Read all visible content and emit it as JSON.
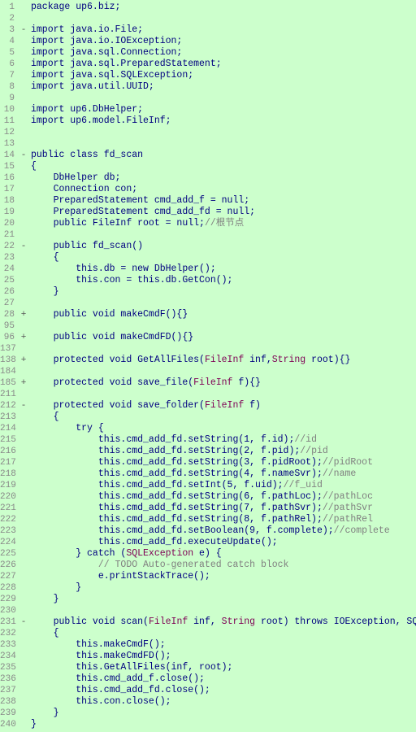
{
  "lines": [
    {
      "num": "1",
      "expand": "",
      "content": "package up6.biz;",
      "tokens": [
        {
          "t": "normal",
          "v": "package up6.biz;"
        }
      ]
    },
    {
      "num": "2",
      "expand": "",
      "content": "",
      "tokens": []
    },
    {
      "num": "3",
      "expand": "-",
      "content": "import java.io.File;",
      "tokens": [
        {
          "t": "normal",
          "v": "import java.io.File;"
        }
      ]
    },
    {
      "num": "4",
      "expand": "",
      "content": "import java.io.IOException;",
      "tokens": [
        {
          "t": "normal",
          "v": "import java.io.IOException;"
        }
      ]
    },
    {
      "num": "5",
      "expand": "",
      "content": "import java.sql.Connection;",
      "tokens": [
        {
          "t": "normal",
          "v": "import java.sql.Connection;"
        }
      ]
    },
    {
      "num": "6",
      "expand": "",
      "content": "import java.sql.PreparedStatement;",
      "tokens": [
        {
          "t": "normal",
          "v": "import java.sql.PreparedStatement;"
        }
      ]
    },
    {
      "num": "7",
      "expand": "",
      "content": "import java.sql.SQLException;",
      "tokens": [
        {
          "t": "normal",
          "v": "import java.sql.SQLException;"
        }
      ]
    },
    {
      "num": "8",
      "expand": "",
      "content": "import java.util.UUID;",
      "tokens": [
        {
          "t": "normal",
          "v": "import java.util.UUID;"
        }
      ]
    },
    {
      "num": "9",
      "expand": "",
      "content": "",
      "tokens": []
    },
    {
      "num": "10",
      "expand": "",
      "content": "import up6.DbHelper;",
      "tokens": [
        {
          "t": "normal",
          "v": "import up6.DbHelper;"
        }
      ]
    },
    {
      "num": "11",
      "expand": "",
      "content": "import up6.model.FileInf;",
      "tokens": [
        {
          "t": "normal",
          "v": "import up6.model.FileInf;"
        }
      ]
    },
    {
      "num": "12",
      "expand": "",
      "content": "",
      "tokens": []
    },
    {
      "num": "13",
      "expand": "",
      "content": "",
      "tokens": []
    },
    {
      "num": "14",
      "expand": "-",
      "content": "public class fd_scan",
      "tokens": [
        {
          "t": "kw",
          "v": "public class fd_scan"
        }
      ]
    },
    {
      "num": "15",
      "expand": "",
      "content": "{",
      "tokens": [
        {
          "t": "normal",
          "v": "{"
        }
      ]
    },
    {
      "num": "16",
      "expand": "",
      "content": "    DbHelper db;",
      "tokens": [
        {
          "t": "normal",
          "v": "    DbHelper db;"
        }
      ]
    },
    {
      "num": "17",
      "expand": "",
      "content": "    Connection con;",
      "tokens": [
        {
          "t": "normal",
          "v": "    Connection con;"
        }
      ]
    },
    {
      "num": "18",
      "expand": "",
      "content": "    PreparedStatement cmd_add_f = null;",
      "tokens": [
        {
          "t": "normal",
          "v": "    PreparedStatement cmd_add_f = null;"
        }
      ]
    },
    {
      "num": "19",
      "expand": "",
      "content": "    PreparedStatement cmd_add_fd = null;",
      "tokens": [
        {
          "t": "normal",
          "v": "    PreparedStatement cmd_add_fd = null;"
        }
      ]
    },
    {
      "num": "20",
      "expand": "",
      "content": "    public FileInf root = null;//根节点",
      "tokens": [
        {
          "t": "normal",
          "v": "    public FileInf root = null;"
        },
        {
          "t": "comment",
          "v": "//根节点"
        }
      ]
    },
    {
      "num": "21",
      "expand": "",
      "content": "",
      "tokens": []
    },
    {
      "num": "22",
      "expand": "-",
      "content": "    public fd_scan()",
      "tokens": [
        {
          "t": "normal",
          "v": "    public fd_scan()"
        }
      ]
    },
    {
      "num": "23",
      "expand": "",
      "content": "    {",
      "tokens": [
        {
          "t": "normal",
          "v": "    {"
        }
      ]
    },
    {
      "num": "24",
      "expand": "",
      "content": "        this.db = new DbHelper();",
      "tokens": [
        {
          "t": "normal",
          "v": "        this.db = new DbHelper();"
        }
      ]
    },
    {
      "num": "25",
      "expand": "",
      "content": "        this.con = this.db.GetCon();",
      "tokens": [
        {
          "t": "normal",
          "v": "        this.con = this.db.GetCon();"
        }
      ]
    },
    {
      "num": "26",
      "expand": "",
      "content": "    }",
      "tokens": [
        {
          "t": "normal",
          "v": "    }"
        }
      ]
    },
    {
      "num": "27",
      "expand": "",
      "content": "",
      "tokens": []
    },
    {
      "num": "28",
      "expand": "+",
      "content": "    public void makeCmdF(){}",
      "tokens": [
        {
          "t": "normal",
          "v": "    public void makeCmdF(){}"
        }
      ]
    },
    {
      "num": "95",
      "expand": "",
      "content": "",
      "tokens": []
    },
    {
      "num": "96",
      "expand": "+",
      "content": "    public void makeCmdFD(){}",
      "tokens": [
        {
          "t": "normal",
          "v": "    public void makeCmdFD(){}"
        }
      ]
    },
    {
      "num": "137",
      "expand": "",
      "content": "",
      "tokens": []
    },
    {
      "num": "138",
      "expand": "+",
      "content": "    protected void GetAllFiles(FileInf inf,String root){}",
      "tokens": [
        {
          "t": "normal",
          "v": "    protected void GetAllFiles("
        },
        {
          "t": "param",
          "v": "FileInf"
        },
        {
          "t": "normal",
          "v": " inf,"
        },
        {
          "t": "param",
          "v": "String"
        },
        {
          "t": "normal",
          "v": " root){}"
        }
      ]
    },
    {
      "num": "184",
      "expand": "",
      "content": "",
      "tokens": []
    },
    {
      "num": "185",
      "expand": "+",
      "content": "    protected void save_file(FileInf f){}",
      "tokens": [
        {
          "t": "normal",
          "v": "    protected void save_file("
        },
        {
          "t": "param",
          "v": "FileInf"
        },
        {
          "t": "normal",
          "v": " f){}"
        }
      ]
    },
    {
      "num": "211",
      "expand": "",
      "content": "",
      "tokens": []
    },
    {
      "num": "212",
      "expand": "-",
      "content": "    protected void save_folder(FileInf f)",
      "tokens": [
        {
          "t": "normal",
          "v": "    protected void save_folder("
        },
        {
          "t": "param",
          "v": "FileInf"
        },
        {
          "t": "normal",
          "v": " f)"
        }
      ]
    },
    {
      "num": "213",
      "expand": "",
      "content": "    {",
      "tokens": [
        {
          "t": "normal",
          "v": "    {"
        }
      ]
    },
    {
      "num": "214",
      "expand": "",
      "content": "        try {",
      "tokens": [
        {
          "t": "normal",
          "v": "        try {"
        }
      ]
    },
    {
      "num": "215",
      "expand": "",
      "content": "            this.cmd_add_fd.setString(1, f.id);//id",
      "tokens": [
        {
          "t": "normal",
          "v": "            this.cmd_add_fd.setString(1, f.id);"
        },
        {
          "t": "comment",
          "v": "//id"
        }
      ]
    },
    {
      "num": "216",
      "expand": "",
      "content": "            this.cmd_add_fd.setString(2, f.pid);//pid",
      "tokens": [
        {
          "t": "normal",
          "v": "            this.cmd_add_fd.setString(2, f.pid);"
        },
        {
          "t": "comment",
          "v": "//pid"
        }
      ]
    },
    {
      "num": "217",
      "expand": "",
      "content": "            this.cmd_add_fd.setString(3, f.pidRoot);//pidRoot",
      "tokens": [
        {
          "t": "normal",
          "v": "            this.cmd_add_fd.setString(3, f.pidRoot);"
        },
        {
          "t": "comment",
          "v": "//pidRoot"
        }
      ]
    },
    {
      "num": "218",
      "expand": "",
      "content": "            this.cmd_add_fd.setString(4, f.nameSvr);//name",
      "tokens": [
        {
          "t": "normal",
          "v": "            this.cmd_add_fd.setString(4, f.nameSvr);"
        },
        {
          "t": "comment",
          "v": "//name"
        }
      ]
    },
    {
      "num": "219",
      "expand": "",
      "content": "            this.cmd_add_fd.setInt(5, f.uid);//f_uid",
      "tokens": [
        {
          "t": "normal",
          "v": "            this.cmd_add_fd.setInt(5, f.uid);"
        },
        {
          "t": "comment",
          "v": "//f_uid"
        }
      ]
    },
    {
      "num": "220",
      "expand": "",
      "content": "            this.cmd_add_fd.setString(6, f.pathLoc);//pathLoc",
      "tokens": [
        {
          "t": "normal",
          "v": "            this.cmd_add_fd.setString(6, f.pathLoc);"
        },
        {
          "t": "comment",
          "v": "//pathLoc"
        }
      ]
    },
    {
      "num": "221",
      "expand": "",
      "content": "            this.cmd_add_fd.setString(7, f.pathSvr);//pathSvr",
      "tokens": [
        {
          "t": "normal",
          "v": "            this.cmd_add_fd.setString(7, f.pathSvr);"
        },
        {
          "t": "comment",
          "v": "//pathSvr"
        }
      ]
    },
    {
      "num": "222",
      "expand": "",
      "content": "            this.cmd_add_fd.setString(8, f.pathRel);//pathRel",
      "tokens": [
        {
          "t": "normal",
          "v": "            this.cmd_add_fd.setString(8, f.pathRel);"
        },
        {
          "t": "comment",
          "v": "//pathRel"
        }
      ]
    },
    {
      "num": "223",
      "expand": "",
      "content": "            this.cmd_add_fd.setBoolean(9, f.complete);//complete",
      "tokens": [
        {
          "t": "normal",
          "v": "            this.cmd_add_fd.setBoolean(9, f.complete);"
        },
        {
          "t": "comment",
          "v": "//complete"
        }
      ]
    },
    {
      "num": "224",
      "expand": "",
      "content": "            this.cmd_add_fd.executeUpdate();",
      "tokens": [
        {
          "t": "normal",
          "v": "            this.cmd_add_fd.executeUpdate();"
        }
      ]
    },
    {
      "num": "225",
      "expand": "",
      "content": "        } catch (SQLException e) {",
      "tokens": [
        {
          "t": "normal",
          "v": "        } catch ("
        },
        {
          "t": "param",
          "v": "SQLException"
        },
        {
          "t": "normal",
          "v": " e) {"
        }
      ]
    },
    {
      "num": "226",
      "expand": "",
      "content": "            // TODO Auto-generated catch block",
      "tokens": [
        {
          "t": "comment",
          "v": "            // TODO Auto-generated catch block"
        }
      ]
    },
    {
      "num": "227",
      "expand": "",
      "content": "            e.printStackTrace();",
      "tokens": [
        {
          "t": "normal",
          "v": "            e.printStackTrace();"
        }
      ]
    },
    {
      "num": "228",
      "expand": "",
      "content": "        }",
      "tokens": [
        {
          "t": "normal",
          "v": "        }"
        }
      ]
    },
    {
      "num": "229",
      "expand": "",
      "content": "    }",
      "tokens": [
        {
          "t": "normal",
          "v": "    }"
        }
      ]
    },
    {
      "num": "230",
      "expand": "",
      "content": "",
      "tokens": []
    },
    {
      "num": "231",
      "expand": "-",
      "content": "    public void scan(FileInf inf, String root) throws IOException, SQLException",
      "tokens": [
        {
          "t": "normal",
          "v": "    public void scan("
        },
        {
          "t": "param",
          "v": "FileInf"
        },
        {
          "t": "normal",
          "v": " inf, "
        },
        {
          "t": "param",
          "v": "String"
        },
        {
          "t": "normal",
          "v": " root) throws IOException, SQLException"
        }
      ]
    },
    {
      "num": "232",
      "expand": "",
      "content": "    {",
      "tokens": [
        {
          "t": "normal",
          "v": "    {"
        }
      ]
    },
    {
      "num": "233",
      "expand": "",
      "content": "        this.makeCmdF();",
      "tokens": [
        {
          "t": "normal",
          "v": "        this.makeCmdF();"
        }
      ]
    },
    {
      "num": "234",
      "expand": "",
      "content": "        this.makeCmdFD();",
      "tokens": [
        {
          "t": "normal",
          "v": "        this.makeCmdFD();"
        }
      ]
    },
    {
      "num": "235",
      "expand": "",
      "content": "        this.GetAllFiles(inf, root);",
      "tokens": [
        {
          "t": "normal",
          "v": "        this.GetAllFiles(inf, root);"
        }
      ]
    },
    {
      "num": "236",
      "expand": "",
      "content": "        this.cmd_add_f.close();",
      "tokens": [
        {
          "t": "normal",
          "v": "        this.cmd_add_f.close();"
        }
      ]
    },
    {
      "num": "237",
      "expand": "",
      "content": "        this.cmd_add_fd.close();",
      "tokens": [
        {
          "t": "normal",
          "v": "        this.cmd_add_fd.close();"
        }
      ]
    },
    {
      "num": "238",
      "expand": "",
      "content": "        this.con.close();",
      "tokens": [
        {
          "t": "normal",
          "v": "        this.con.close();"
        }
      ]
    },
    {
      "num": "239",
      "expand": "",
      "content": "    }",
      "tokens": [
        {
          "t": "normal",
          "v": "    }"
        }
      ]
    },
    {
      "num": "240",
      "expand": "",
      "content": "}",
      "tokens": [
        {
          "t": "normal",
          "v": "}"
        }
      ]
    }
  ]
}
